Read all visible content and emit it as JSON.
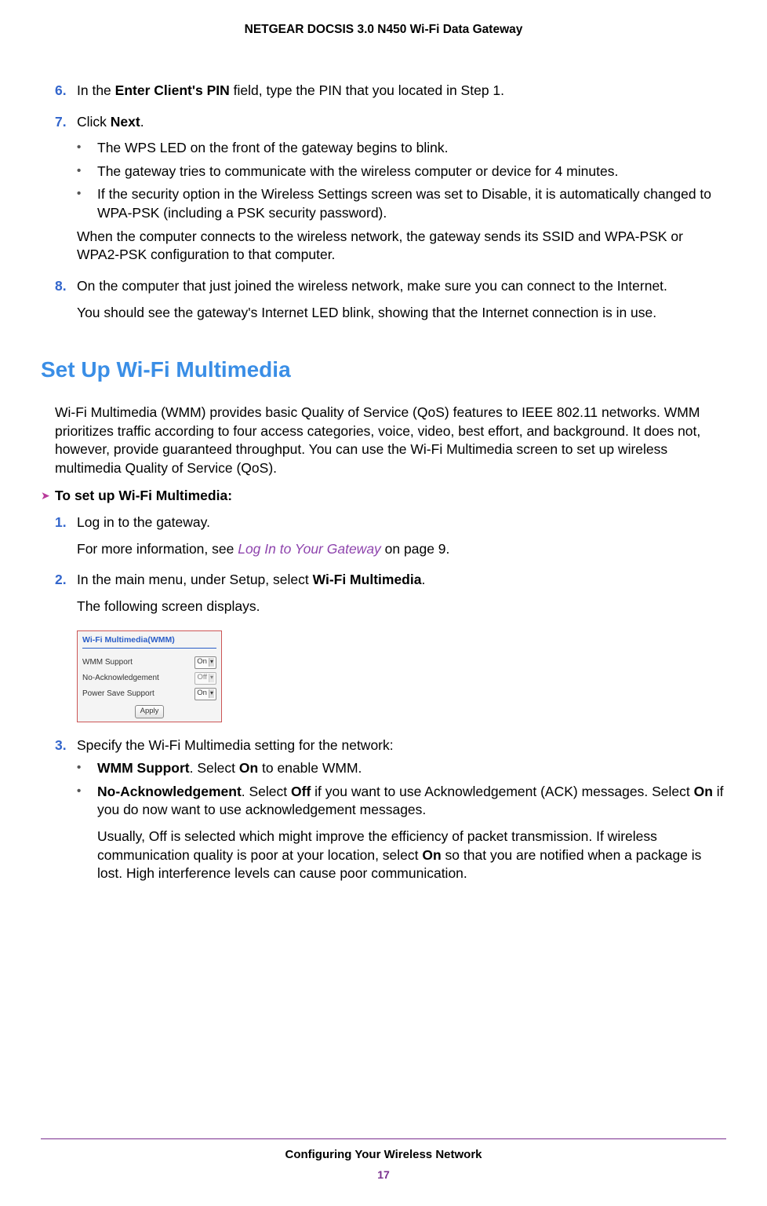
{
  "header": "NETGEAR DOCSIS 3.0 N450 Wi-Fi Data Gateway",
  "steps_top": {
    "s6": {
      "num": "6.",
      "before": "In the ",
      "bold1": "Enter Client's PIN",
      "after": " field, type the PIN that you located in Step 1."
    },
    "s7": {
      "num": "7.",
      "before": "Click ",
      "bold1": "Next",
      "after": ".",
      "b1": "The WPS LED on the front of the gateway begins to blink.",
      "b2": "The gateway tries to communicate with the wireless computer or device for 4 minutes.",
      "b3": "If the security option in the Wireless Settings screen was set to Disable, it is automatically changed to WPA-PSK (including a PSK security password).",
      "p_after": "When the computer connects to the wireless network, the gateway sends its SSID and WPA-PSK or WPA2-PSK configuration to that computer."
    },
    "s8": {
      "num": "8.",
      "p1": "On the computer that just joined the wireless network, make sure you can connect to the Internet.",
      "p2": "You should see the gateway's Internet LED blink, showing that the Internet connection is in use."
    }
  },
  "section_heading": "Set Up Wi-Fi Multimedia",
  "intro_para": "Wi-Fi Multimedia (WMM) provides basic Quality of Service (QoS) features to IEEE 802.11 networks. WMM prioritizes traffic according to four access categories, voice, video, best effort, and background. It does not, however, provide guaranteed throughput. You can use the Wi-Fi Multimedia screen to set up wireless multimedia Quality of Service (QoS).",
  "proc_heading": "To set up Wi-Fi Multimedia:",
  "steps_proc": {
    "s1": {
      "num": "1.",
      "p1": "Log in to the gateway.",
      "p2a": "For more information, see ",
      "link": "Log In to Your Gateway",
      "p2b": " on page 9."
    },
    "s2": {
      "num": "2.",
      "p1a": "In the main menu, under Setup, select ",
      "bold": "Wi-Fi Multimedia",
      "p1b": ".",
      "p2": "The following screen displays."
    },
    "screenshot": {
      "title": "Wi-Fi Multimedia(WMM)",
      "rows": [
        {
          "label": "WMM Support",
          "value": "On"
        },
        {
          "label": "No-Acknowledgement",
          "value": "Off"
        },
        {
          "label": "Power Save Support",
          "value": "On"
        }
      ],
      "apply": "Apply"
    },
    "s3": {
      "num": "3.",
      "p1": "Specify the Wi-Fi Multimedia setting for the network:",
      "b1_bold": "WMM Support",
      "b1_mid": ". Select ",
      "b1_bold2": "On",
      "b1_after": " to enable WMM.",
      "b2_bold": "No-Acknowledgement",
      "b2_a": ". Select ",
      "b2_bold2": "Off",
      "b2_b": " if you want to use Acknowledgement (ACK) messages. Select ",
      "b2_bold3": "On",
      "b2_c": " if you do now want to use acknowledgement messages.",
      "b2_p2a": "Usually, Off is selected which might improve the efficiency of packet transmission. If wireless communication quality is poor at your location, select ",
      "b2_p2_bold": "On",
      "b2_p2b": " so that you are notified when a package is lost. High interference levels can cause poor communication."
    }
  },
  "footer": {
    "title": "Configuring Your Wireless Network",
    "page": "17"
  }
}
